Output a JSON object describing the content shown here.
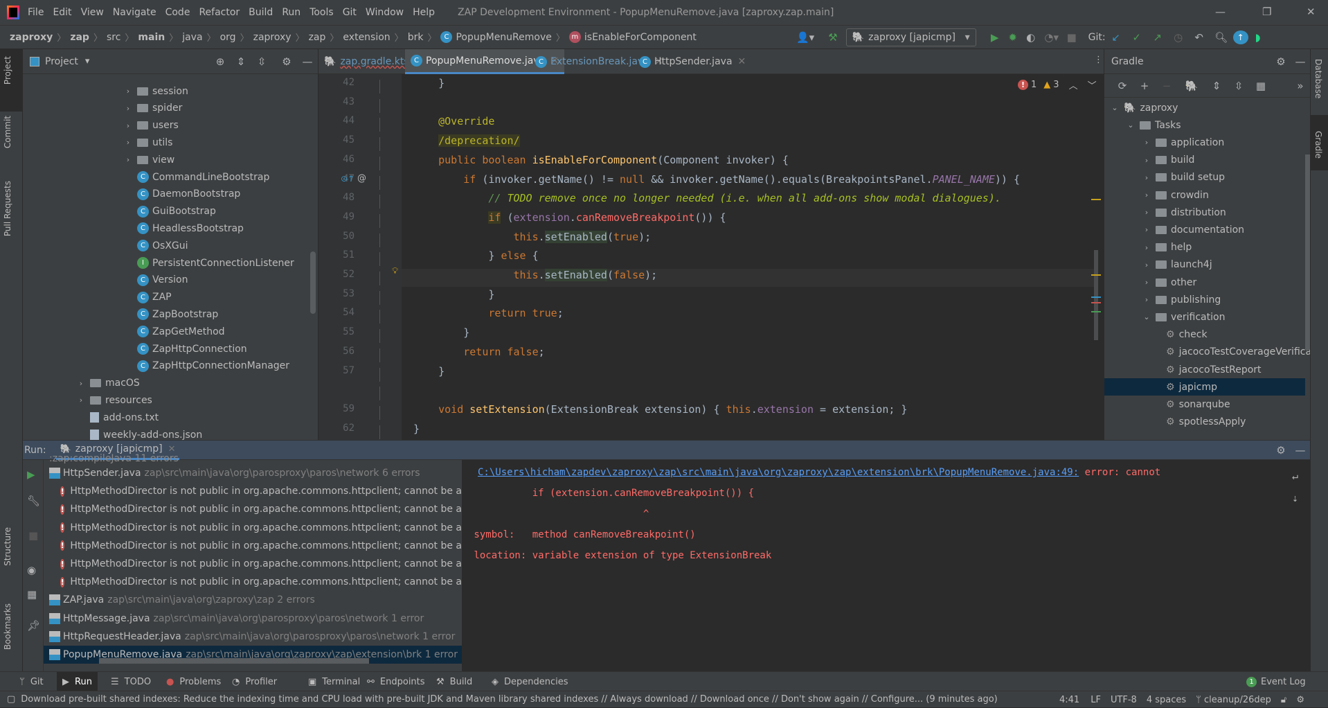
{
  "titlebar": {
    "menu": [
      "File",
      "Edit",
      "View",
      "Navigate",
      "Code",
      "Refactor",
      "Build",
      "Run",
      "Tools",
      "Git",
      "Window",
      "Help"
    ],
    "title": "ZAP Development Environment - PopupMenuRemove.java [zaproxy.zap.main]"
  },
  "breadcrumb": [
    "zaproxy",
    "zap",
    "src",
    "main",
    "java",
    "org",
    "zaproxy",
    "zap",
    "extension",
    "brk"
  ],
  "breadcrumb_class": "PopupMenuRemove",
  "breadcrumb_method": "isEnableForComponent",
  "toolbar": {
    "run_config": "zaproxy [japicmp]",
    "git_label": "Git:"
  },
  "left_stripe": {
    "project": "Project",
    "commit": "Commit",
    "pull_requests": "Pull Requests",
    "structure": "Structure",
    "bookmarks": "Bookmarks"
  },
  "right_stripe": {
    "database": "Database",
    "gradle": "Gradle"
  },
  "project": {
    "title": "Project",
    "items": [
      {
        "label": "session",
        "type": "folder",
        "indent": 1
      },
      {
        "label": "spider",
        "type": "folder",
        "indent": 1
      },
      {
        "label": "users",
        "type": "folder",
        "indent": 1
      },
      {
        "label": "utils",
        "type": "folder",
        "indent": 1
      },
      {
        "label": "view",
        "type": "folder",
        "indent": 1
      },
      {
        "label": "CommandLineBootstrap",
        "type": "class",
        "indent": 1
      },
      {
        "label": "DaemonBootstrap",
        "type": "class",
        "indent": 1
      },
      {
        "label": "GuiBootstrap",
        "type": "class",
        "indent": 1
      },
      {
        "label": "HeadlessBootstrap",
        "type": "class",
        "indent": 1
      },
      {
        "label": "OsXGui",
        "type": "class",
        "indent": 1
      },
      {
        "label": "PersistentConnectionListener",
        "type": "interface",
        "indent": 1
      },
      {
        "label": "Version",
        "type": "class",
        "indent": 1
      },
      {
        "label": "ZAP",
        "type": "class",
        "indent": 1
      },
      {
        "label": "ZapBootstrap",
        "type": "class",
        "indent": 1
      },
      {
        "label": "ZapGetMethod",
        "type": "class",
        "indent": 1
      },
      {
        "label": "ZapHttpConnection",
        "type": "class",
        "indent": 1
      },
      {
        "label": "ZapHttpConnectionManager",
        "type": "class",
        "indent": 1
      },
      {
        "label": "macOS",
        "type": "folder",
        "indent": 0
      },
      {
        "label": "resources",
        "type": "folder",
        "indent": 0
      },
      {
        "label": "add-ons.txt",
        "type": "file",
        "indent": 0
      },
      {
        "label": "weekly-add-ons.json",
        "type": "file",
        "indent": 0
      }
    ]
  },
  "editor": {
    "tabs": [
      {
        "label": "zap.gradle.kts"
      },
      {
        "label": "PopupMenuRemove.java",
        "active": true
      },
      {
        "label": "ExtensionBreak.java"
      },
      {
        "label": "HttpSender.java"
      }
    ],
    "errors": "1",
    "warnings": "3",
    "lines": [
      {
        "n": "42",
        "s": [
          [
            "    }",
            ""
          ]
        ]
      },
      {
        "n": "43",
        "s": []
      },
      {
        "n": "44",
        "s": [
          [
            "    ",
            ""
          ],
          [
            "@Override",
            "ann"
          ]
        ]
      },
      {
        "n": "45",
        "s": [
          [
            "    ",
            ""
          ],
          [
            "/deprecation/",
            "ann hly"
          ]
        ]
      },
      {
        "n": "46",
        "s": [
          [
            "    ",
            ""
          ],
          [
            "public boolean ",
            "kw"
          ],
          [
            "isEnableForComponent",
            "fn"
          ],
          [
            "(Component invoker) {",
            ""
          ]
        ]
      },
      {
        "n": "47",
        "s": [
          [
            "        ",
            ""
          ],
          [
            "if ",
            "kw"
          ],
          [
            "(invoker.getName() != ",
            ""
          ],
          [
            "null ",
            "kw"
          ],
          [
            "&& invoker.getName().equals(BreakpointsPanel.",
            ""
          ],
          [
            "PANEL_NAME",
            "cst"
          ],
          [
            ")) {",
            ""
          ]
        ]
      },
      {
        "n": "48",
        "s": [
          [
            "            ",
            ""
          ],
          [
            "// ",
            "cm"
          ],
          [
            "TODO remove once no longer needed (i.e. when all add-ons show modal dialogues).",
            "todo"
          ]
        ]
      },
      {
        "n": "49",
        "s": [
          [
            "            ",
            ""
          ],
          [
            "if",
            "kw hly"
          ],
          [
            " (",
            ""
          ],
          [
            "extension",
            "fld"
          ],
          [
            ".",
            ""
          ],
          [
            "canRemoveBreakpoint",
            "err"
          ],
          [
            "()) {",
            ""
          ]
        ]
      },
      {
        "n": "50",
        "s": [
          [
            "                ",
            ""
          ],
          [
            "this",
            "kw"
          ],
          [
            ".",
            ""
          ],
          [
            "setEnabled",
            "hlg"
          ],
          [
            "(",
            ""
          ],
          [
            "true",
            "kw"
          ],
          [
            ");",
            ""
          ]
        ]
      },
      {
        "n": "51",
        "s": [
          [
            "            } ",
            ""
          ],
          [
            "else ",
            "kw"
          ],
          [
            "{",
            ""
          ]
        ]
      },
      {
        "n": "52",
        "s": [
          [
            "                ",
            ""
          ],
          [
            "this",
            "kw"
          ],
          [
            ".",
            ""
          ],
          [
            "setEnabled",
            "hlg"
          ],
          [
            "(",
            ""
          ],
          [
            "false",
            "kw"
          ],
          [
            ");",
            ""
          ]
        ]
      },
      {
        "n": "53",
        "s": [
          [
            "            }",
            ""
          ]
        ]
      },
      {
        "n": "54",
        "s": [
          [
            "            ",
            ""
          ],
          [
            "return true",
            "kw"
          ],
          [
            ";",
            ""
          ]
        ]
      },
      {
        "n": "55",
        "s": [
          [
            "        }",
            ""
          ]
        ]
      },
      {
        "n": "56",
        "s": [
          [
            "        ",
            ""
          ],
          [
            "return false",
            "kw"
          ],
          [
            ";",
            ""
          ]
        ]
      },
      {
        "n": "57",
        "s": [
          [
            "    }",
            ""
          ]
        ]
      },
      {
        "n": "",
        "s": []
      },
      {
        "n": "59",
        "s": [
          [
            "    ",
            ""
          ],
          [
            "void ",
            "kw"
          ],
          [
            "setExtension",
            "fn"
          ],
          [
            "(ExtensionBreak extension) { ",
            ""
          ],
          [
            "this",
            "kw"
          ],
          [
            ".",
            ""
          ],
          [
            "extension",
            "fld"
          ],
          [
            " = extension; }",
            ""
          ]
        ]
      },
      {
        "n": "62",
        "s": [
          [
            "}",
            ""
          ]
        ]
      }
    ]
  },
  "gradle": {
    "title": "Gradle",
    "items": [
      {
        "label": "zaproxy",
        "type": "root",
        "indent": 0,
        "open": true
      },
      {
        "label": "Tasks",
        "type": "folder",
        "indent": 1,
        "open": true
      },
      {
        "label": "application",
        "type": "folder",
        "indent": 2
      },
      {
        "label": "build",
        "type": "folder",
        "indent": 2
      },
      {
        "label": "build setup",
        "type": "folder",
        "indent": 2
      },
      {
        "label": "crowdin",
        "type": "folder",
        "indent": 2
      },
      {
        "label": "distribution",
        "type": "folder",
        "indent": 2
      },
      {
        "label": "documentation",
        "type": "folder",
        "indent": 2
      },
      {
        "label": "help",
        "type": "folder",
        "indent": 2
      },
      {
        "label": "launch4j",
        "type": "folder",
        "indent": 2
      },
      {
        "label": "other",
        "type": "folder",
        "indent": 2
      },
      {
        "label": "publishing",
        "type": "folder",
        "indent": 2
      },
      {
        "label": "verification",
        "type": "folder",
        "indent": 2,
        "open": true
      },
      {
        "label": "check",
        "type": "task",
        "indent": 3
      },
      {
        "label": "jacocoTestCoverageVerification",
        "type": "task",
        "indent": 3
      },
      {
        "label": "jacocoTestReport",
        "type": "task",
        "indent": 3
      },
      {
        "label": "japicmp",
        "type": "task",
        "indent": 3,
        "selected": true
      },
      {
        "label": "sonarqube",
        "type": "task",
        "indent": 3
      },
      {
        "label": "spotlessApply",
        "type": "task",
        "indent": 3
      }
    ]
  },
  "run": {
    "label": "Run:",
    "tab": "zaproxy [japicmp]",
    "tree": [
      {
        "file": "HttpSender.java",
        "path": "zap\\src\\main\\java\\org\\parosproxy\\paros\\network 6 errors"
      },
      {
        "msg": "HttpMethodDirector is not public in org.apache.commons.httpclient; cannot be a"
      },
      {
        "msg": "HttpMethodDirector is not public in org.apache.commons.httpclient; cannot be a"
      },
      {
        "msg": "HttpMethodDirector is not public in org.apache.commons.httpclient; cannot be a"
      },
      {
        "msg": "HttpMethodDirector is not public in org.apache.commons.httpclient; cannot be a"
      },
      {
        "msg": "HttpMethodDirector is not public in org.apache.commons.httpclient; cannot be a"
      },
      {
        "msg": "HttpMethodDirector is not public in org.apache.commons.httpclient; cannot be a"
      },
      {
        "file": "ZAP.java",
        "path": "zap\\src\\main\\java\\org\\zaproxy\\zap 2 errors"
      },
      {
        "file": "HttpMessage.java",
        "path": "zap\\src\\main\\java\\org\\parosproxy\\paros\\network 1 error"
      },
      {
        "file": "HttpRequestHeader.java",
        "path": "zap\\src\\main\\java\\org\\parosproxy\\paros\\network 1 error"
      },
      {
        "file": "PopupMenuRemove.java",
        "path": "zap\\src\\main\\java\\org\\zaproxy\\zap\\extension\\brk 1 error",
        "selected": true
      }
    ],
    "output": {
      "link": "C:\\Users\\hicham\\zapdev\\zaproxy\\zap\\src\\main\\java\\org\\zaproxy\\zap\\extension\\brk\\PopupMenuRemove.java:49:",
      "error": " error: cannot",
      "lines": [
        "           if (extension.canRemoveBreakpoint()) {",
        "                              ^",
        " symbol:   method canRemoveBreakpoint()",
        " location: variable extension of type ExtensionBreak"
      ]
    }
  },
  "bottom_tabs": [
    "Git",
    "Run",
    "TODO",
    "Problems",
    "Profiler",
    "Terminal",
    "Endpoints",
    "Build",
    "Dependencies"
  ],
  "event_log": {
    "count": "1",
    "label": "Event Log"
  },
  "status": {
    "message": "Download pre-built shared indexes: Reduce the indexing time and CPU load with pre-built JDK and Maven library shared indexes // Always download // Download once // Don't show again // Configure... (9 minutes ago)",
    "position": "4:41",
    "line_sep": "LF",
    "encoding": "UTF-8",
    "indent": "4 spaces",
    "branch": "cleanup/26dep"
  }
}
